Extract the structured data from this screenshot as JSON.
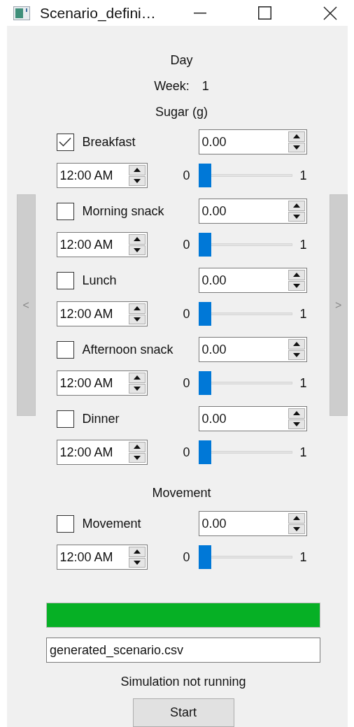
{
  "window": {
    "title": "Scenario_defini…"
  },
  "header": {
    "day": "Day",
    "week_label": "Week:",
    "week": "1",
    "section": "Sugar (g)"
  },
  "nav": {
    "previous": "<",
    "next": ">"
  },
  "meals": [
    {
      "name": "Breakfast",
      "checked": true,
      "amount": "0.00",
      "time": "12:00 AM",
      "slider_min": "0",
      "slider_max": "1",
      "level": 0
    },
    {
      "name": "Morning snack",
      "checked": false,
      "amount": "0.00",
      "time": "12:00 AM",
      "slider_min": "0",
      "slider_max": "1",
      "level": 0
    },
    {
      "name": "Lunch",
      "checked": false,
      "amount": "0.00",
      "time": "12:00 AM",
      "slider_min": "0",
      "slider_max": "1",
      "level": 0
    },
    {
      "name": "Afternoon snack",
      "checked": false,
      "amount": "0.00",
      "time": "12:00 AM",
      "slider_min": "0",
      "slider_max": "1",
      "level": 0
    },
    {
      "name": "Dinner",
      "checked": false,
      "amount": "0.00",
      "time": "12:00 AM",
      "slider_min": "0",
      "slider_max": "1",
      "level": 0
    }
  ],
  "movement": {
    "heading": "Movement",
    "items": [
      {
        "name": "Movement",
        "checked": false,
        "amount": "0.00",
        "time": "12:00 AM",
        "slider_min": "0",
        "slider_max": "1",
        "level": 0
      }
    ]
  },
  "progress": {
    "level": 1
  },
  "output_file": {
    "value": "generated_scenario.csv"
  },
  "status": "Simulation not running",
  "start_button": "Start"
}
